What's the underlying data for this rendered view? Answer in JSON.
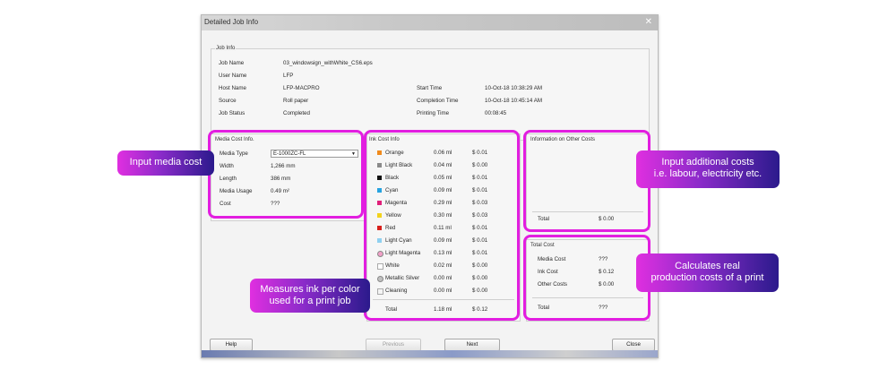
{
  "window": {
    "title": "Detailed Job Info",
    "close_glyph": "✕"
  },
  "job_info": {
    "title": "Job Info",
    "left": [
      {
        "label": "Job Name",
        "value": "03_windowsign_withWhite_CS6.eps"
      },
      {
        "label": "User Name",
        "value": "LFP"
      },
      {
        "label": "Host Name",
        "value": "LFP-MACPRO"
      },
      {
        "label": "Source",
        "value": "Roll paper"
      },
      {
        "label": "Job Status",
        "value": "Completed"
      }
    ],
    "right": [
      {
        "label": "Start Time",
        "value": "10-Oct-18 10:38:29 AM"
      },
      {
        "label": "Completion Time",
        "value": "10-Oct-18 10:45:14 AM"
      },
      {
        "label": "Printing Time",
        "value": "00:08:45"
      }
    ]
  },
  "media_cost": {
    "title": "Media Cost Info.",
    "media_type_label": "Media Type",
    "media_type_value": "E-1000ZC-FL",
    "rows": [
      {
        "label": "Width",
        "value": "1,266 mm"
      },
      {
        "label": "Length",
        "value": "386 mm"
      },
      {
        "label": "Media Usage",
        "value": "0.49 m²"
      },
      {
        "label": "Cost",
        "value": "???"
      }
    ]
  },
  "ink_cost": {
    "title": "Ink Cost Info",
    "inks": [
      {
        "name": "Orange",
        "amount": "0.06 ml",
        "cost": "$ 0.01",
        "color": "#f08a1c"
      },
      {
        "name": "Light Black",
        "amount": "0.04 ml",
        "cost": "$ 0.00",
        "color": "#8a8a8a"
      },
      {
        "name": "Black",
        "amount": "0.05 ml",
        "cost": "$ 0.01",
        "color": "#111111"
      },
      {
        "name": "Cyan",
        "amount": "0.09 ml",
        "cost": "$ 0.01",
        "color": "#27a3e0"
      },
      {
        "name": "Magenta",
        "amount": "0.29 ml",
        "cost": "$ 0.03",
        "color": "#e0207a"
      },
      {
        "name": "Yellow",
        "amount": "0.30 ml",
        "cost": "$ 0.03",
        "color": "#f2d21c"
      },
      {
        "name": "Red",
        "amount": "0.11 ml",
        "cost": "$ 0.01",
        "color": "#d8201c"
      },
      {
        "name": "Light Cyan",
        "amount": "0.09 ml",
        "cost": "$ 0.01",
        "color": "#8fd0f0"
      },
      {
        "name": "Light Magenta",
        "amount": "0.13 ml",
        "cost": "$ 0.01",
        "color": "#f2a0c8"
      },
      {
        "name": "White",
        "amount": "0.02 ml",
        "cost": "$ 0.00",
        "color": "#ffffff"
      },
      {
        "name": "Metallic Silver",
        "amount": "0.00 ml",
        "cost": "$ 0.00",
        "color": "#c0c0c0"
      },
      {
        "name": "Cleaning",
        "amount": "0.00 ml",
        "cost": "$ 0.00",
        "color": "#f4f4f4"
      }
    ],
    "total_label": "Total",
    "total_amount": "1.18 ml",
    "total_cost": "$ 0.12"
  },
  "other_costs": {
    "title": "Information on Other Costs",
    "total_label": "Total",
    "total_value": "$ 0.00"
  },
  "total_cost": {
    "title": "Total Cost",
    "rows": [
      {
        "label": "Media Cost",
        "value": "???"
      },
      {
        "label": "Ink Cost",
        "value": "$ 0.12"
      },
      {
        "label": "Other Costs",
        "value": "$ 0.00"
      }
    ],
    "total_label": "Total",
    "total_value": "???"
  },
  "buttons": {
    "help": "Help",
    "previous": "Previous",
    "next": "Next",
    "close": "Close"
  },
  "callouts": {
    "media": "Input media cost",
    "ink_line1": "Measures ink per color",
    "ink_line2": "used for a print job",
    "other_line1": "Input additional costs",
    "other_line2": "i.e. labour, electricity etc.",
    "total_line1": "Calculates real",
    "total_line2": "production costs of a print"
  },
  "colors": {
    "highlight": "#e21ee0",
    "callout_start": "#e02fe0",
    "callout_end": "#2b1a8c"
  }
}
